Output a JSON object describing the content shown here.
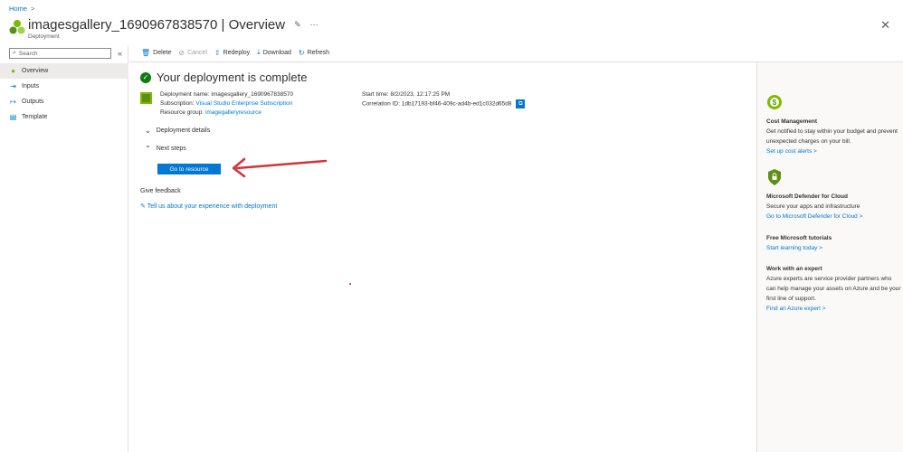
{
  "breadcrumb": {
    "home": "Home",
    "sep": ">"
  },
  "header": {
    "title": "imagesgallery_1690967838570 | Overview",
    "subtitle": "Deployment",
    "pin_icon": "pin-icon",
    "more_icon": "more-icon"
  },
  "sidebar": {
    "search_placeholder": "Search",
    "items": [
      {
        "label": "Overview",
        "icon": "overview-icon"
      },
      {
        "label": "Inputs",
        "icon": "inputs-icon"
      },
      {
        "label": "Outputs",
        "icon": "outputs-icon"
      },
      {
        "label": "Template",
        "icon": "template-icon"
      }
    ]
  },
  "toolbar": {
    "delete": "Delete",
    "cancel": "Cancel",
    "redeploy": "Redeploy",
    "download": "Download",
    "refresh": "Refresh"
  },
  "main": {
    "status_title": "Your deployment is complete",
    "deployment_name_label": "Deployment name:",
    "deployment_name_value": "imagesgallery_1690967838570",
    "subscription_label": "Subscription:",
    "subscription_value": "Visual Studio Enterprise Subscription",
    "resource_group_label": "Resource group:",
    "resource_group_value": "imagegalleryresource",
    "start_time_label": "Start time:",
    "start_time_value": "8/2/2023, 12:17:25 PM",
    "correlation_label": "Correlation ID:",
    "correlation_value": "1db17193-bf46-409c-ad4b-ed1c032d65d8",
    "deployment_details": "Deployment details",
    "next_steps": "Next steps",
    "go_to_resource": "Go to resource",
    "give_feedback": "Give feedback",
    "feedback_link": "Tell us about your experience with deployment"
  },
  "right_pane": {
    "cost": {
      "title": "Cost Management",
      "text": "Get notified to stay within your budget and prevent unexpected charges on your bill.",
      "link": "Set up cost alerts >"
    },
    "defender": {
      "title": "Microsoft Defender for Cloud",
      "text": "Secure your apps and infrastructure",
      "link": "Go to Microsoft Defender for Cloud >"
    },
    "tutorials": {
      "title": "Free Microsoft tutorials",
      "link": "Start learning today >"
    },
    "expert": {
      "title": "Work with an expert",
      "text": "Azure experts are service provider partners who can help manage your assets on Azure and be your first line of support.",
      "link": "Find an Azure expert >"
    }
  },
  "colors": {
    "accent": "#0078d4",
    "success": "#107c10",
    "arrow": "#d13438"
  }
}
